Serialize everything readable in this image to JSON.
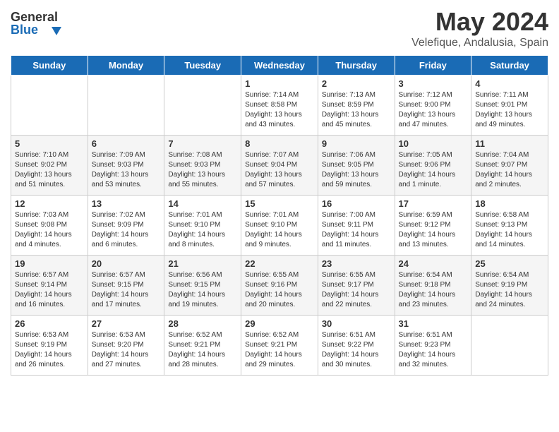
{
  "header": {
    "logo_general": "General",
    "logo_blue": "Blue",
    "title": "May 2024",
    "subtitle": "Velefique, Andalusia, Spain"
  },
  "days_of_week": [
    "Sunday",
    "Monday",
    "Tuesday",
    "Wednesday",
    "Thursday",
    "Friday",
    "Saturday"
  ],
  "weeks": [
    [
      {
        "day": "",
        "sunrise": "",
        "sunset": "",
        "daylight": ""
      },
      {
        "day": "",
        "sunrise": "",
        "sunset": "",
        "daylight": ""
      },
      {
        "day": "",
        "sunrise": "",
        "sunset": "",
        "daylight": ""
      },
      {
        "day": "1",
        "sunrise": "Sunrise: 7:14 AM",
        "sunset": "Sunset: 8:58 PM",
        "daylight": "Daylight: 13 hours and 43 minutes."
      },
      {
        "day": "2",
        "sunrise": "Sunrise: 7:13 AM",
        "sunset": "Sunset: 8:59 PM",
        "daylight": "Daylight: 13 hours and 45 minutes."
      },
      {
        "day": "3",
        "sunrise": "Sunrise: 7:12 AM",
        "sunset": "Sunset: 9:00 PM",
        "daylight": "Daylight: 13 hours and 47 minutes."
      },
      {
        "day": "4",
        "sunrise": "Sunrise: 7:11 AM",
        "sunset": "Sunset: 9:01 PM",
        "daylight": "Daylight: 13 hours and 49 minutes."
      }
    ],
    [
      {
        "day": "5",
        "sunrise": "Sunrise: 7:10 AM",
        "sunset": "Sunset: 9:02 PM",
        "daylight": "Daylight: 13 hours and 51 minutes."
      },
      {
        "day": "6",
        "sunrise": "Sunrise: 7:09 AM",
        "sunset": "Sunset: 9:03 PM",
        "daylight": "Daylight: 13 hours and 53 minutes."
      },
      {
        "day": "7",
        "sunrise": "Sunrise: 7:08 AM",
        "sunset": "Sunset: 9:03 PM",
        "daylight": "Daylight: 13 hours and 55 minutes."
      },
      {
        "day": "8",
        "sunrise": "Sunrise: 7:07 AM",
        "sunset": "Sunset: 9:04 PM",
        "daylight": "Daylight: 13 hours and 57 minutes."
      },
      {
        "day": "9",
        "sunrise": "Sunrise: 7:06 AM",
        "sunset": "Sunset: 9:05 PM",
        "daylight": "Daylight: 13 hours and 59 minutes."
      },
      {
        "day": "10",
        "sunrise": "Sunrise: 7:05 AM",
        "sunset": "Sunset: 9:06 PM",
        "daylight": "Daylight: 14 hours and 1 minute."
      },
      {
        "day": "11",
        "sunrise": "Sunrise: 7:04 AM",
        "sunset": "Sunset: 9:07 PM",
        "daylight": "Daylight: 14 hours and 2 minutes."
      }
    ],
    [
      {
        "day": "12",
        "sunrise": "Sunrise: 7:03 AM",
        "sunset": "Sunset: 9:08 PM",
        "daylight": "Daylight: 14 hours and 4 minutes."
      },
      {
        "day": "13",
        "sunrise": "Sunrise: 7:02 AM",
        "sunset": "Sunset: 9:09 PM",
        "daylight": "Daylight: 14 hours and 6 minutes."
      },
      {
        "day": "14",
        "sunrise": "Sunrise: 7:01 AM",
        "sunset": "Sunset: 9:10 PM",
        "daylight": "Daylight: 14 hours and 8 minutes."
      },
      {
        "day": "15",
        "sunrise": "Sunrise: 7:01 AM",
        "sunset": "Sunset: 9:10 PM",
        "daylight": "Daylight: 14 hours and 9 minutes."
      },
      {
        "day": "16",
        "sunrise": "Sunrise: 7:00 AM",
        "sunset": "Sunset: 9:11 PM",
        "daylight": "Daylight: 14 hours and 11 minutes."
      },
      {
        "day": "17",
        "sunrise": "Sunrise: 6:59 AM",
        "sunset": "Sunset: 9:12 PM",
        "daylight": "Daylight: 14 hours and 13 minutes."
      },
      {
        "day": "18",
        "sunrise": "Sunrise: 6:58 AM",
        "sunset": "Sunset: 9:13 PM",
        "daylight": "Daylight: 14 hours and 14 minutes."
      }
    ],
    [
      {
        "day": "19",
        "sunrise": "Sunrise: 6:57 AM",
        "sunset": "Sunset: 9:14 PM",
        "daylight": "Daylight: 14 hours and 16 minutes."
      },
      {
        "day": "20",
        "sunrise": "Sunrise: 6:57 AM",
        "sunset": "Sunset: 9:15 PM",
        "daylight": "Daylight: 14 hours and 17 minutes."
      },
      {
        "day": "21",
        "sunrise": "Sunrise: 6:56 AM",
        "sunset": "Sunset: 9:15 PM",
        "daylight": "Daylight: 14 hours and 19 minutes."
      },
      {
        "day": "22",
        "sunrise": "Sunrise: 6:55 AM",
        "sunset": "Sunset: 9:16 PM",
        "daylight": "Daylight: 14 hours and 20 minutes."
      },
      {
        "day": "23",
        "sunrise": "Sunrise: 6:55 AM",
        "sunset": "Sunset: 9:17 PM",
        "daylight": "Daylight: 14 hours and 22 minutes."
      },
      {
        "day": "24",
        "sunrise": "Sunrise: 6:54 AM",
        "sunset": "Sunset: 9:18 PM",
        "daylight": "Daylight: 14 hours and 23 minutes."
      },
      {
        "day": "25",
        "sunrise": "Sunrise: 6:54 AM",
        "sunset": "Sunset: 9:19 PM",
        "daylight": "Daylight: 14 hours and 24 minutes."
      }
    ],
    [
      {
        "day": "26",
        "sunrise": "Sunrise: 6:53 AM",
        "sunset": "Sunset: 9:19 PM",
        "daylight": "Daylight: 14 hours and 26 minutes."
      },
      {
        "day": "27",
        "sunrise": "Sunrise: 6:53 AM",
        "sunset": "Sunset: 9:20 PM",
        "daylight": "Daylight: 14 hours and 27 minutes."
      },
      {
        "day": "28",
        "sunrise": "Sunrise: 6:52 AM",
        "sunset": "Sunset: 9:21 PM",
        "daylight": "Daylight: 14 hours and 28 minutes."
      },
      {
        "day": "29",
        "sunrise": "Sunrise: 6:52 AM",
        "sunset": "Sunset: 9:21 PM",
        "daylight": "Daylight: 14 hours and 29 minutes."
      },
      {
        "day": "30",
        "sunrise": "Sunrise: 6:51 AM",
        "sunset": "Sunset: 9:22 PM",
        "daylight": "Daylight: 14 hours and 30 minutes."
      },
      {
        "day": "31",
        "sunrise": "Sunrise: 6:51 AM",
        "sunset": "Sunset: 9:23 PM",
        "daylight": "Daylight: 14 hours and 32 minutes."
      },
      {
        "day": "",
        "sunrise": "",
        "sunset": "",
        "daylight": ""
      }
    ]
  ]
}
